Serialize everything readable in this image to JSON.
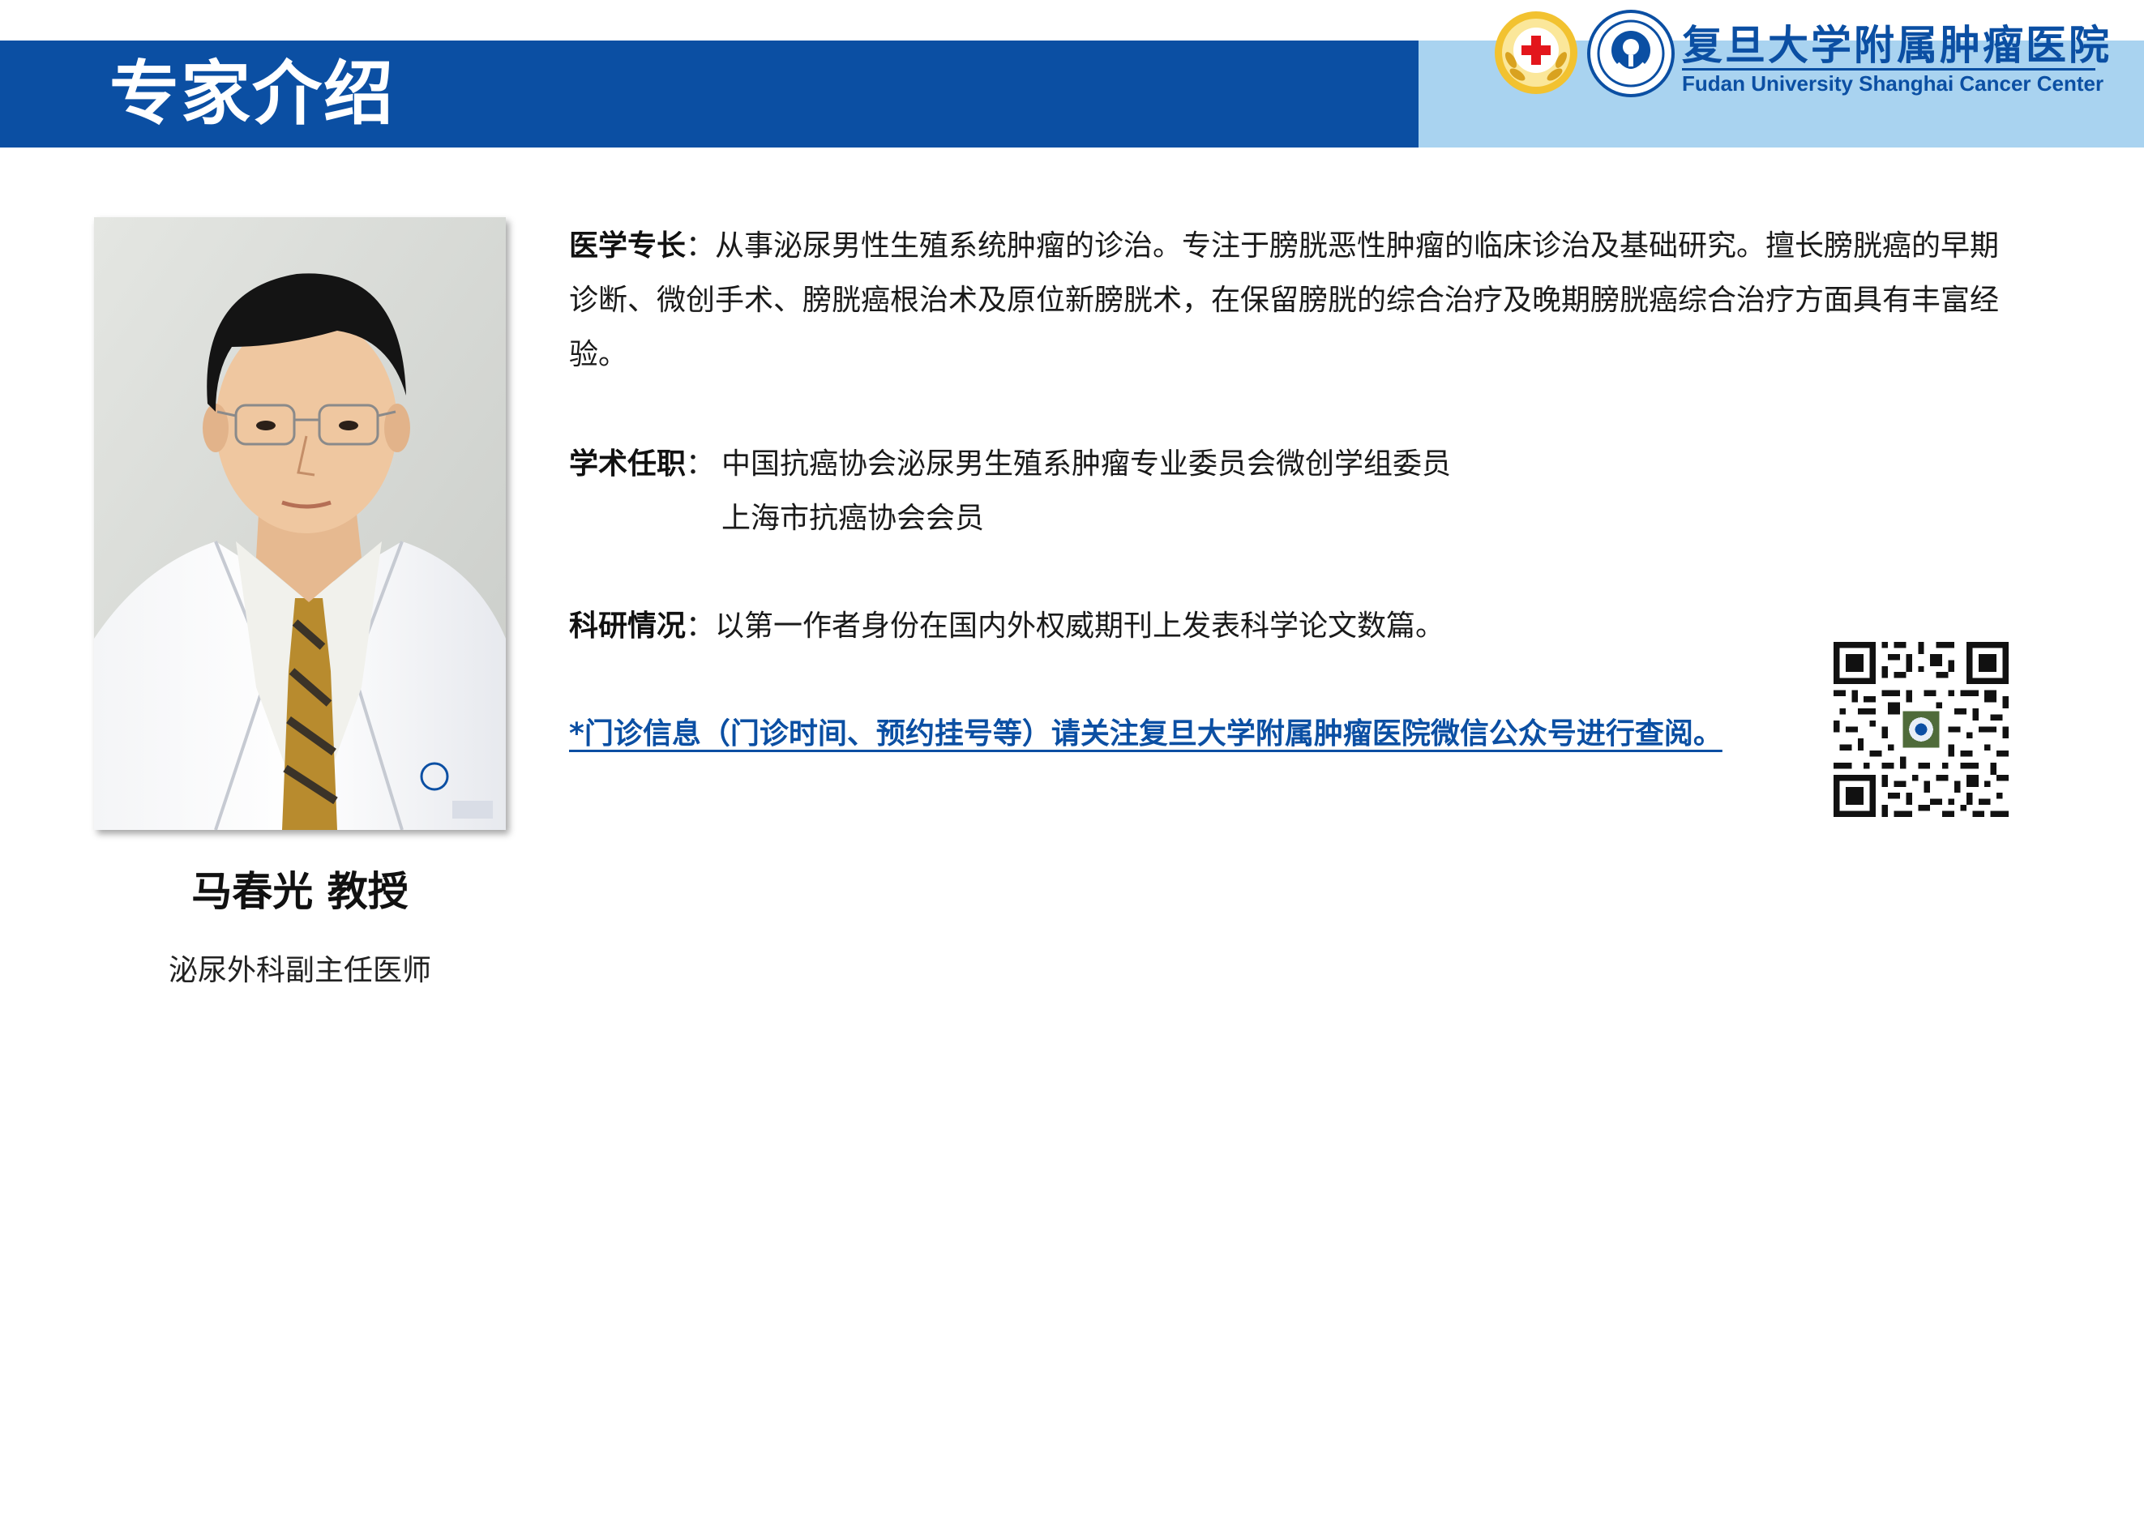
{
  "header": {
    "title": "专家介绍",
    "hospital_name_cn": "复旦大学附属肿瘤医院",
    "hospital_name_en": "Fudan University Shanghai Cancer Center",
    "brand_color": "#0b4fa3",
    "right_band_color": "#a9d3f0"
  },
  "expert": {
    "name": "马春光 教授",
    "department": "泌尿外科副主任医师",
    "photo_icon": "portrait-photo"
  },
  "profile": {
    "specialty_label": "医学专长",
    "specialty_text": "：从事泌尿男性生殖系统肿瘤的诊治。专注于膀胱恶性肿瘤的临床诊治及基础研究。擅长膀胱癌的早期诊断、微创手术、膀胱癌根治术及原位新膀胱术，在保留膀胱的综合治疗及晚期膀胱癌综合治疗方面具有丰富经验。",
    "academic_label": "学术任职",
    "academic_colon": "：",
    "academic_items": [
      "中国抗癌协会泌尿男生殖系肿瘤专业委员会微创学组委员",
      "上海市抗癌协会会员"
    ],
    "research_label": "科研情况",
    "research_text": "：以第一作者身份在国内外权威期刊上发表科学论文数篇。"
  },
  "notice": {
    "text": "*门诊信息（门诊时间、预约挂号等）请关注复旦大学附属肿瘤医院微信公众号进行查阅。"
  },
  "qr_code": {
    "icon": "qr-code-icon"
  }
}
